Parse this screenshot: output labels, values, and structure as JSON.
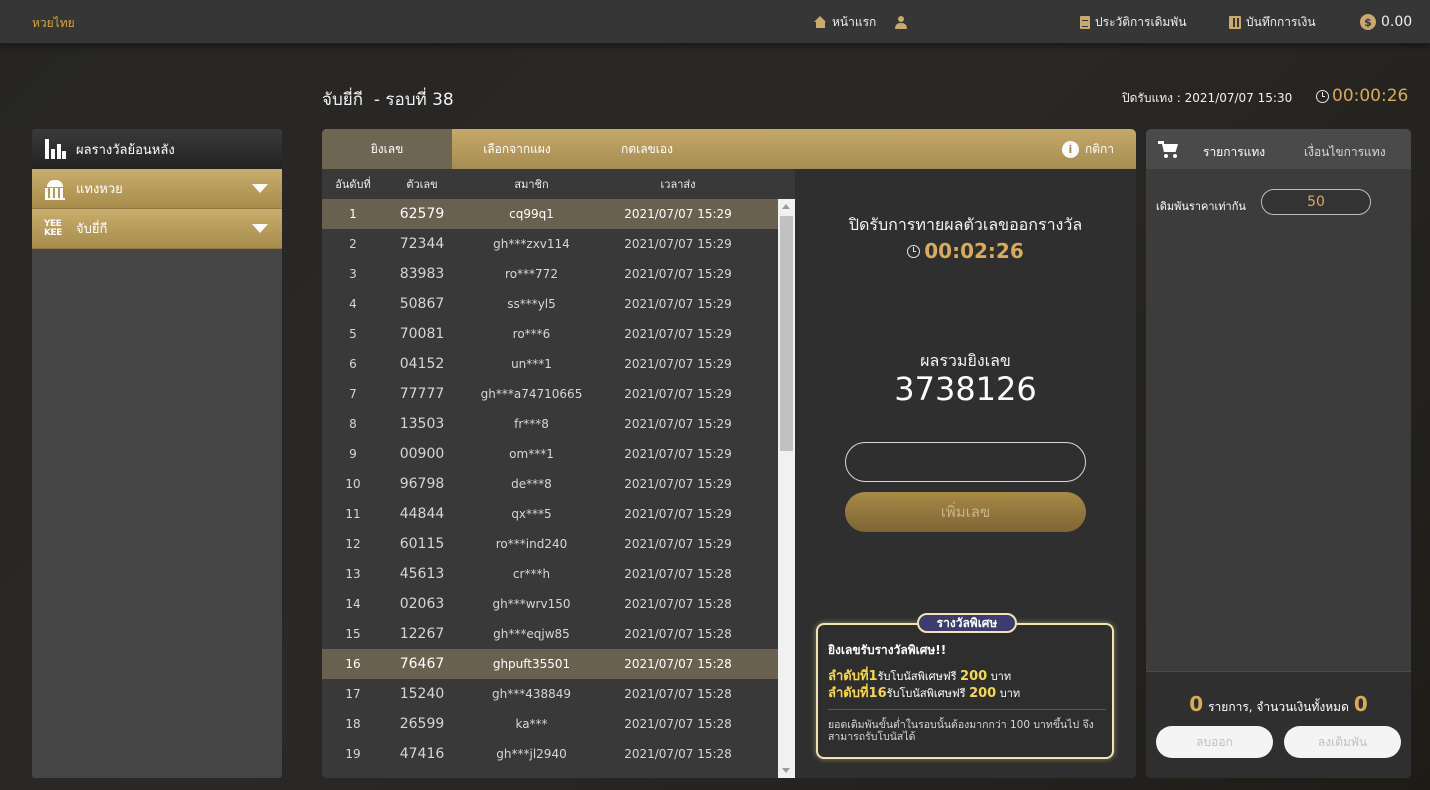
{
  "nav": {
    "brand": "หวยไทย",
    "home": "หน้าแรก",
    "history": "ประวัติการเดิมพัน",
    "finance": "บันทึกการเงิน",
    "balance": "0.00",
    "balance_icon": "dollar-coin-icon"
  },
  "header": {
    "title": "จับยี่กี  - รอบที่ 38",
    "close_info": "ปิดรับแทง : 2021/07/07 15:30",
    "countdown": "00:00:26"
  },
  "sidebar": {
    "head": "ผลรางวัลย้อนหลัง",
    "items": [
      {
        "label": "แทงหวย",
        "icon": "bank-icon"
      },
      {
        "label": "จับยี่กี",
        "icon_text": "YEE KEE"
      }
    ]
  },
  "tabs": [
    {
      "label": "ยิงเลข",
      "active": true
    },
    {
      "label": "เลือกจากแผง",
      "active": false
    },
    {
      "label": "กดเลขเอง",
      "active": false
    }
  ],
  "rules_label": "กติกา",
  "table": {
    "headers": [
      "อันดับที่",
      "ตัวเลข",
      "สมาชิก",
      "เวลาส่ง"
    ],
    "rows": [
      [
        "1",
        "62579",
        "cq99q1",
        "2021/07/07 15:29"
      ],
      [
        "2",
        "72344",
        "gh***zxv114",
        "2021/07/07 15:29"
      ],
      [
        "3",
        "83983",
        "ro***772",
        "2021/07/07 15:29"
      ],
      [
        "4",
        "50867",
        "ss***yl5",
        "2021/07/07 15:29"
      ],
      [
        "5",
        "70081",
        "ro***6",
        "2021/07/07 15:29"
      ],
      [
        "6",
        "04152",
        "un***1",
        "2021/07/07 15:29"
      ],
      [
        "7",
        "77777",
        "gh***a74710665",
        "2021/07/07 15:29"
      ],
      [
        "8",
        "13503",
        "fr***8",
        "2021/07/07 15:29"
      ],
      [
        "9",
        "00900",
        "om***1",
        "2021/07/07 15:29"
      ],
      [
        "10",
        "96798",
        "de***8",
        "2021/07/07 15:29"
      ],
      [
        "11",
        "44844",
        "qx***5",
        "2021/07/07 15:29"
      ],
      [
        "12",
        "60115",
        "ro***ind240",
        "2021/07/07 15:29"
      ],
      [
        "13",
        "45613",
        "cr***h",
        "2021/07/07 15:28"
      ],
      [
        "14",
        "02063",
        "gh***wrv150",
        "2021/07/07 15:28"
      ],
      [
        "15",
        "12267",
        "gh***eqjw85",
        "2021/07/07 15:28"
      ],
      [
        "16",
        "76467",
        "ghpuft35501",
        "2021/07/07 15:28"
      ],
      [
        "17",
        "15240",
        "gh***438849",
        "2021/07/07 15:28"
      ],
      [
        "18",
        "26599",
        "ka***",
        "2021/07/07 15:28"
      ],
      [
        "19",
        "47416",
        "gh***jl2940",
        "2021/07/07 15:28"
      ]
    ],
    "highlight_rows": [
      1,
      16
    ]
  },
  "shoot": {
    "close_heading": "ปิดรับการทายผลตัวเลขออกรางวัล",
    "close_timer": "00:02:26",
    "sum_label": "ผลรวมยิงเลข",
    "sum_value": "3738126",
    "input_value": "",
    "add_button": "เพิ่มเลข"
  },
  "bonus": {
    "tag": "รางวัลพิเศษ",
    "title": "ยิงเลขรับรางวัลพิเศษ!!",
    "line1_a": "ลำดับที่1",
    "line1_b": "รับโบนัสพิเศษฟรี",
    "line1_amount": "200",
    "line1_unit": "บาท",
    "line2_a": "ลำดับที่16",
    "line2_b": "รับโบนัสพิเศษฟรี",
    "line2_amount": "200",
    "line2_unit": "บาท",
    "note": "ยอดเดิมพันขั้นต่ำในรอบนั้นต้องมากกว่า 100 บาทขึ้นไป จึงสามารถรับโบนัสได้"
  },
  "cart": {
    "tab1": "รายการแทง",
    "tab2": "เงื่อนไขการแทง",
    "same_price_label": "เดิมพันราคาเท่ากัน",
    "same_price_value": "50",
    "count": "0",
    "count_label": "รายการ, จำนวนเงินทั้งหมด",
    "total": "0",
    "clear_button": "ลบออก",
    "submit_button": "ลงเดิมพัน"
  },
  "colors": {
    "accent_gold": "#d7ab5e",
    "tab_gold": "#c4a86a",
    "highlight_row": "#6a604f",
    "bonus_yellow": "#f6d84a"
  }
}
